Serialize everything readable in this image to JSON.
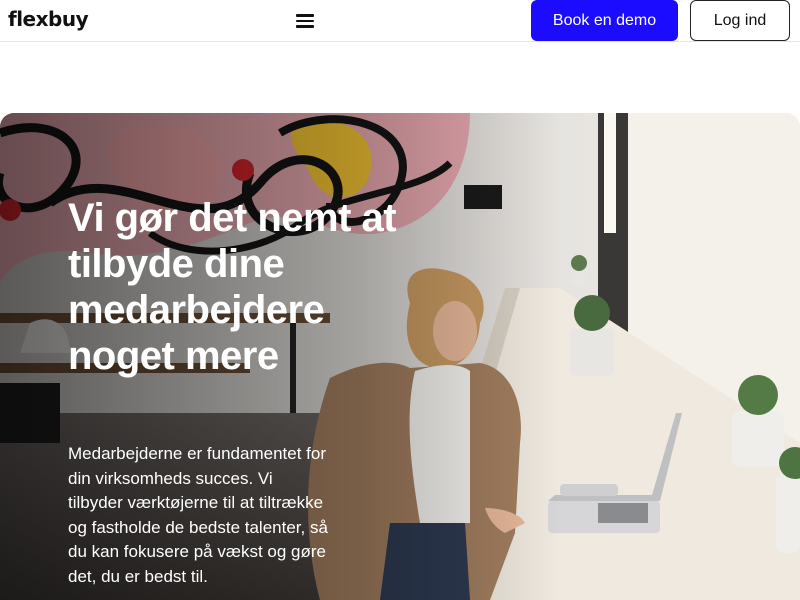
{
  "header": {
    "logo": "flexbuy",
    "menu_icon": "hamburger-menu-icon",
    "demo_label": "Book en demo",
    "login_label": "Log ind"
  },
  "hero": {
    "title": "Vi gør det nemt at tilbyde dine medarbejdere noget mere",
    "text": "Medarbejderne er fundamentet for din virksomheds succes. Vi tilbyder værktøjerne til at tiltrække og fastholde de bedste talenter, så du kan fokusere på vækst og gøre det, du er bedst til."
  },
  "colors": {
    "accent": "#1c0cff",
    "hero_text": "#ffffff"
  }
}
